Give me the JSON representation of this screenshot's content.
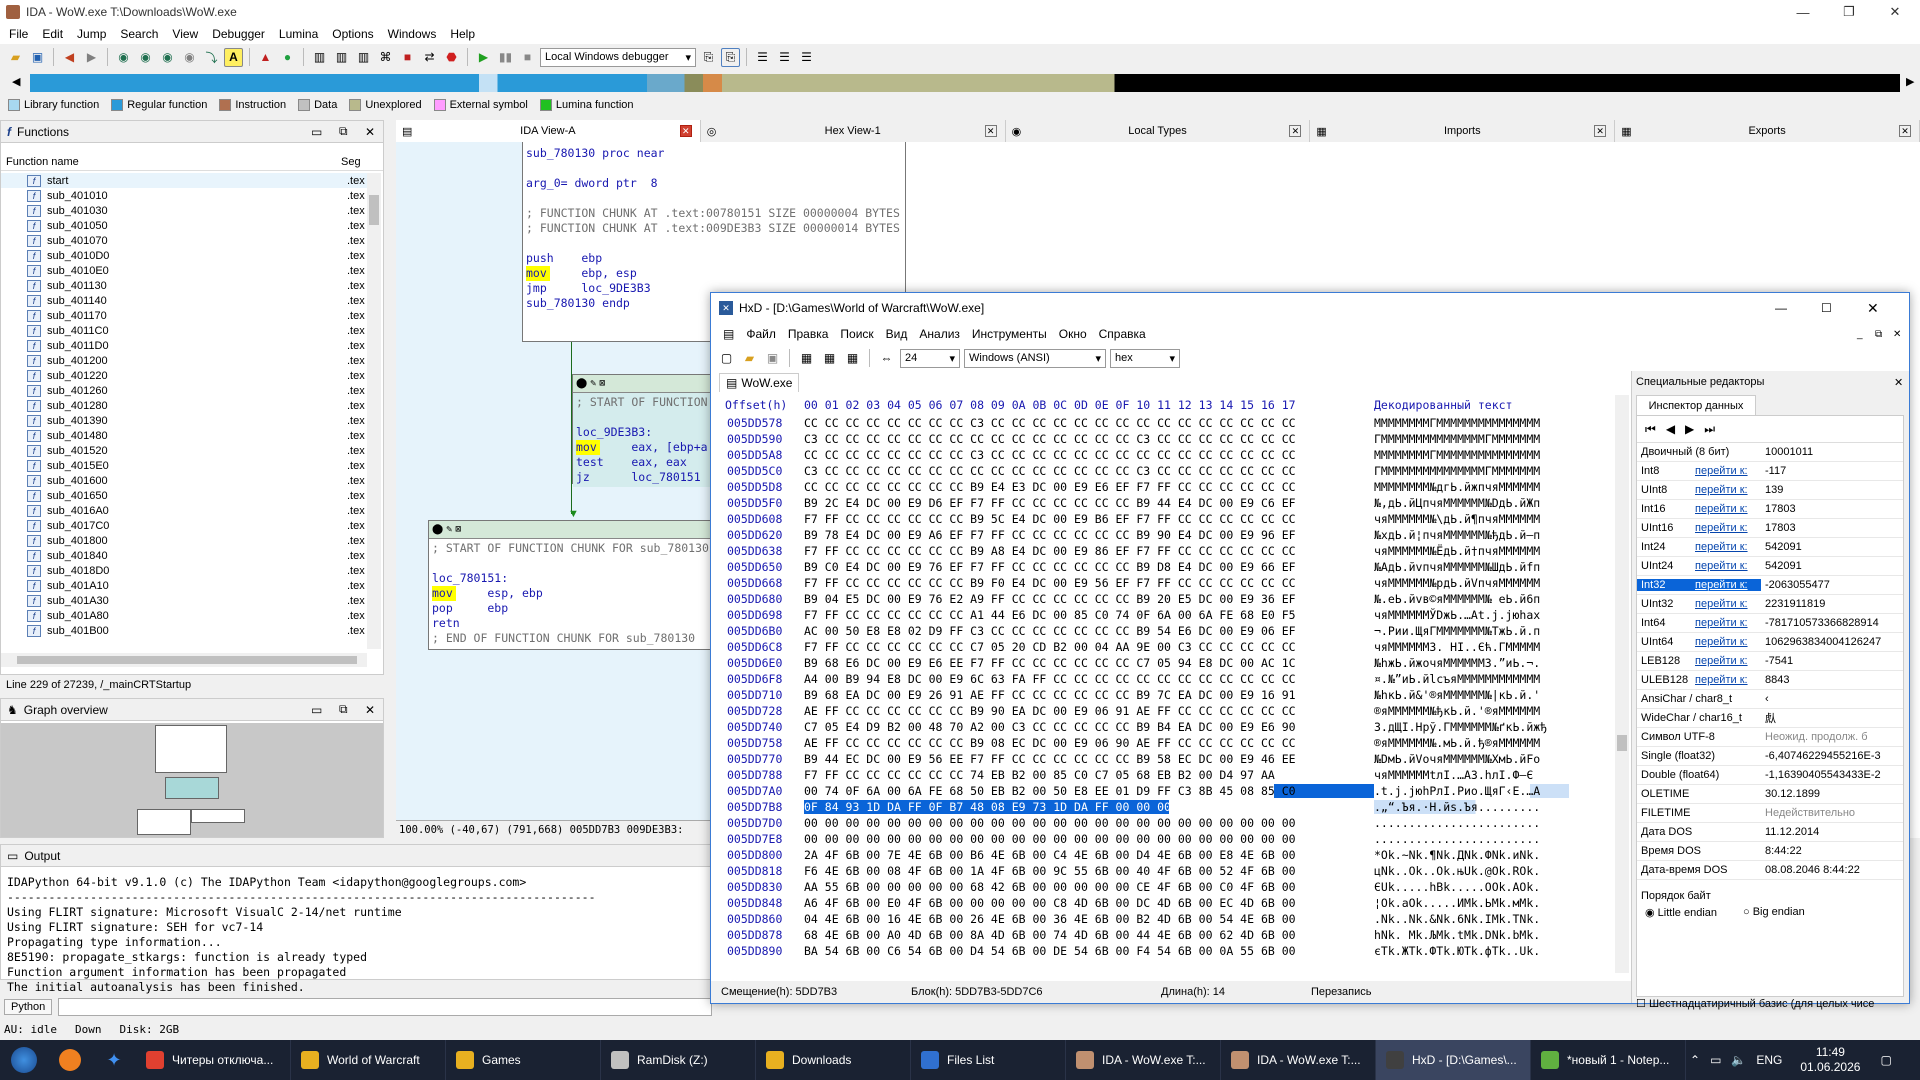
{
  "window": {
    "title": "IDA - WoW.exe T:\\Downloads\\WoW.exe",
    "minimize": "—",
    "maximize": "❐",
    "close": "✕"
  },
  "menu": [
    "File",
    "Edit",
    "Jump",
    "Search",
    "View",
    "Debugger",
    "Lumina",
    "Options",
    "Windows",
    "Help"
  ],
  "toolbar": {
    "debugger": "Local Windows debugger"
  },
  "legend": [
    {
      "label": "Library function",
      "color": "#a8d8f0"
    },
    {
      "label": "Regular function",
      "color": "#2a9ad8"
    },
    {
      "label": "Instruction",
      "color": "#b07050"
    },
    {
      "label": "Data",
      "color": "#c0c0c0"
    },
    {
      "label": "Unexplored",
      "color": "#b8b98c"
    },
    {
      "label": "External symbol",
      "color": "#ff9cff"
    },
    {
      "label": "Lumina function",
      "color": "#20c020"
    }
  ],
  "functions": {
    "title": "Functions",
    "col_name": "Function name",
    "col_seg": "Seg",
    "items": [
      "start",
      "sub_401010",
      "sub_401030",
      "sub_401050",
      "sub_401070",
      "sub_4010D0",
      "sub_4010E0",
      "sub_401130",
      "sub_401140",
      "sub_401170",
      "sub_4011C0",
      "sub_4011D0",
      "sub_401200",
      "sub_401220",
      "sub_401260",
      "sub_401280",
      "sub_401390",
      "sub_401480",
      "sub_401520",
      "sub_4015E0",
      "sub_401600",
      "sub_401650",
      "sub_4016A0",
      "sub_4017C0",
      "sub_401800",
      "sub_401840",
      "sub_4018D0",
      "sub_401A10",
      "sub_401A30",
      "sub_401A80",
      "sub_401B00"
    ],
    "seg": ".tex",
    "status": "Line 229 of 27239, /_mainCRTStartup"
  },
  "graph_overview": {
    "title": "Graph overview"
  },
  "tabs": [
    {
      "label": "IDA View-A",
      "icon": "▤"
    },
    {
      "label": "Hex View-1",
      "icon": "◎"
    },
    {
      "label": "Local Types",
      "icon": "◉"
    },
    {
      "label": "Imports",
      "icon": "▦"
    },
    {
      "label": "Exports",
      "icon": "▦"
    }
  ],
  "ida_nodes": {
    "n1": [
      "sub_780130 proc near",
      "",
      "arg_0= dword ptr  8",
      "",
      "; FUNCTION CHUNK AT .text:00780151 SIZE 00000004 BYTES",
      "; FUNCTION CHUNK AT .text:009DE3B3 SIZE 00000014 BYTES",
      "",
      "push    ebp",
      "mov     ebp, esp",
      "jmp     loc_9DE3B3",
      "sub_780130 endp"
    ],
    "n2": [
      "; START OF FUNCTION",
      "",
      "loc_9DE3B3:",
      "mov     eax, [ebp+a",
      "test    eax, eax",
      "jz      loc_780151"
    ],
    "n3": [
      "; START OF FUNCTION CHUNK FOR sub_780130",
      "",
      "loc_780151:",
      "mov     esp, ebp",
      "pop     ebp",
      "retn",
      "; END OF FUNCTION CHUNK FOR sub_780130"
    ]
  },
  "graph_status": "100.00% (-40,67) (791,668) 005DD7B3 009DE3B3:",
  "output": {
    "title": "Output",
    "lines": [
      "IDAPython 64-bit v9.1.0 (c) The IDAPython Team <idapython@googlegroups.com>",
      "-------------------------------------------------------------------------------------",
      "Using FLIRT signature: Microsoft VisualC 2-14/net runtime",
      "Using FLIRT signature: SEH for vc7-14",
      "Propagating type information...",
      "8E5190: propagate_stkargs: function is already typed",
      "Function argument information has been propagated",
      "The initial autoanalysis has been finished."
    ]
  },
  "python_btn": "Python",
  "status": {
    "au": "AU:  idle",
    "down": "Down",
    "disk": "Disk: 2GB"
  },
  "hxd": {
    "title": "HxD - [D:\\Games\\World of Warcraft\\WoW.exe]",
    "menu": [
      "Файл",
      "Правка",
      "Поиск",
      "Вид",
      "Анализ",
      "Инструменты",
      "Окно",
      "Справка"
    ],
    "bytes_per_row": "24",
    "encoding": "Windows (ANSI)",
    "base": "hex",
    "file_tab": "WoW.exe",
    "header_offset": "Offset(h)",
    "header_cols": "00 01 02 03 04 05 06 07 08 09 0A 0B 0C 0D 0E 0F 10 11 12 13 14 15 16 17",
    "header_decoded": "Декодированный текст",
    "rows": [
      [
        "005DD578",
        "CC CC CC CC CC CC CC CC C3 CC CC CC CC CC CC CC CC CC CC CC CC CC CC CC",
        "ММММММММГМММММММММММММММ"
      ],
      [
        "005DD590",
        "C3 CC CC CC CC CC CC CC CC CC CC CC CC CC CC CC C3 CC CC CC CC CC CC CC",
        "ГМММММММММММММММГМММММММ"
      ],
      [
        "005DD5A8",
        "CC CC CC CC CC CC CC CC C3 CC CC CC CC CC CC CC CC CC CC CC CC CC CC CC",
        "ММММММММГМММММММММММММММ"
      ],
      [
        "005DD5C0",
        "C3 CC CC CC CC CC CC CC CC CC CC CC CC CC CC CC C3 CC CC CC CC CC CC CC",
        "ГМММММММММММММММГМММММММ"
      ],
      [
        "005DD5D8",
        "CC CC CC CC CC CC CC CC B9 E4 E3 DC 00 E9 E6 EF F7 FF CC CC CC CC CC CC",
        "ММММММММ№дгЬ.йжпчяММММММ"
      ],
      [
        "005DD5F0",
        "B9 2C E4 DC 00 E9 D6 EF F7 FF CC CC CC CC CC CC B9 44 E4 DC 00 E9 C6 EF",
        "№,дЬ.йЦпчяММММММ№DдЬ.йЖп"
      ],
      [
        "005DD608",
        "F7 FF CC CC CC CC CC CC B9 5C E4 DC 00 E9 B6 EF F7 FF CC CC CC CC CC CC",
        "чяММММММ№\\дЬ.й¶пчяММММММ"
      ],
      [
        "005DD620",
        "B9 78 E4 DC 00 E9 A6 EF F7 FF CC CC CC CC CC CC B9 90 E4 DC 00 E9 96 EF",
        "№xдЬ.й¦пчяММММММ№ђдЬ.й–п"
      ],
      [
        "005DD638",
        "F7 FF CC CC CC CC CC CC B9 A8 E4 DC 00 E9 86 EF F7 FF CC CC CC CC CC CC",
        "чяММММММ№ЁдЬ.й†пчяММММММ"
      ],
      [
        "005DD650",
        "B9 C0 E4 DC 00 E9 76 EF F7 FF CC CC CC CC CC CC B9 D8 E4 DC 00 E9 66 EF",
        "№АдЬ.йvпчяММММММ№ШдЬ.йfп"
      ],
      [
        "005DD668",
        "F7 FF CC CC CC CC CC CC B9 F0 E4 DC 00 E9 56 EF F7 FF CC CC CC CC CC CC",
        "чяММММММ№рдЬ.йVпчяММММММ"
      ],
      [
        "005DD680",
        "B9 04 E5 DC 00 E9 76 E2 A9 FF CC CC CC CC CC CC B9 20 E5 DC 00 E9 36 EF",
        "№.еЬ.йvв©яММММММ№ еЬ.й6п"
      ],
      [
        "005DD698",
        "F7 FF CC CC CC CC CC CC A1 44 E6 DC 00 85 C0 74 0F 6A 00 6A FE 68 E0 F5",
        "чяММММММЎDжЬ.…Аt.j.jюhаx"
      ],
      [
        "005DD6B0",
        "AC 00 50 E8 E8 02 D9 FF C3 CC CC CC CC CC CC CC B9 54 E6 DC 00 E9 06 EF",
        "¬.Pии.ЩяГМММММММ№TжЬ.й.п"
      ],
      [
        "005DD6C8",
        "F7 FF CC CC CC CC CC CC C7 05 20 CD B2 00 04 AA 9E 00 C3 CC CC CC CC CC",
        "чяММММММЗ. НІ..Єћ.ГМММММ"
      ],
      [
        "005DD6E0",
        "B9 68 E6 DC 00 E9 E6 EE F7 FF CC CC CC CC CC CC C7 05 94 E8 DC 00 AC 1C",
        "№hжЬ.йжочяММММММЗ.”иЬ.¬."
      ],
      [
        "005DD6F8",
        "A4 00 B9 94 E8 DC 00 E9 6C 63 FA FF CC CC CC CC CC CC CC CC CC CC CC CC",
        "¤.№”иЬ.йlсъяММММММММММММ"
      ],
      [
        "005DD710",
        "B9 68 EA DC 00 E9 26 91 AE FF CC CC CC CC CC CC B9 7C EA DC 00 E9 16 91",
        "№hкЬ.й&'®яММММММ№|кЬ.й.'"
      ],
      [
        "005DD728",
        "AE FF CC CC CC CC CC CC B9 90 EA DC 00 E9 06 91 AE FF CC CC CC CC CC CC",
        "®яММММММ№ђкЬ.й.'®яММММММ"
      ],
      [
        "005DD740",
        "C7 05 E4 D9 B2 00 48 70 A2 00 C3 CC CC CC CC CC B9 B4 EA DC 00 E9 E6 90",
        "З.дЩІ.Hpў.ГММММММ№ґкЬ.йжђ"
      ],
      [
        "005DD758",
        "AE FF CC CC CC CC CC CC B9 08 EC DC 00 E9 06 90 AE FF CC CC CC CC CC CC",
        "®яММММММ№.мЬ.й.ђ®яММММММ"
      ],
      [
        "005DD770",
        "B9 44 EC DC 00 E9 56 EE F7 FF CC CC CC CC CC CC B9 58 EC DC 00 E9 46 EE",
        "№DмЬ.йVочяММММММ№XмЬ.йFо"
      ],
      [
        "005DD788",
        "F7 FF CC CC CC CC CC CC 74 EB B2 00 85 C0 C7 05 68 EB B2 00 D4 97 AA",
        "чяММММММtлІ.…АЗ.hлІ.Ф—Є"
      ],
      [
        "005DD7A0",
        "00 74 0F 6A 00 6A FE 68 50 EB B2 00 50 E8 EE 01 D9 FF C3 8B 45 08 85 C0",
        ".t.j.jюhPлІ.Pио.ЩяГ‹E.…А"
      ],
      [
        "005DD7B8",
        "0F 84 93 1D DA FF 0F B7 48 08 E9 73 1D DA FF 00 00 00 00 00 00 00 00 00",
        ".„“.Ъя.·H.йs.Ъя........."
      ],
      [
        "005DD7D0",
        "00 00 00 00 00 00 00 00 00 00 00 00 00 00 00 00 00 00 00 00 00 00 00 00",
        "........................"
      ],
      [
        "005DD7E8",
        "00 00 00 00 00 00 00 00 00 00 00 00 00 00 00 00 00 00 00 00 00 00 00 00",
        "........................"
      ],
      [
        "005DD800",
        "2A 4F 6B 00 7E 4E 6B 00 B6 4E 6B 00 C4 4E 6B 00 D4 4E 6B 00 E8 4E 6B 00",
        "*Ok.~Nk.¶Nk.ДNk.ФNk.иNk."
      ],
      [
        "005DD818",
        "F6 4E 6B 00 08 4F 6B 00 1A 4F 6B 00 9C 55 6B 00 40 4F 6B 00 52 4F 6B 00",
        "цNk..Ok..Ok.њUk.@Ok.ROk."
      ],
      [
        "005DD830",
        "AA 55 6B 00 00 00 00 00 68 42 6B 00 00 00 00 00 CE 4F 6B 00 C0 4F 6B 00",
        "ЄUk.....hBk.....ОOk.АOk."
      ],
      [
        "005DD848",
        "A6 4F 6B 00 E0 4F 6B 00 00 00 00 00 C8 4D 6B 00 DC 4D 6B 00 EC 4D 6B 00",
        "¦Ok.аOk.....ИMk.ЬMk.мMk."
      ],
      [
        "005DD860",
        "04 4E 6B 00 16 4E 6B 00 26 4E 6B 00 36 4E 6B 00 B2 4D 6B 00 54 4E 6B 00",
        ".Nk..Nk.&Nk.6Nk.ІMk.TNk."
      ],
      [
        "005DD878",
        "68 4E 6B 00 A0 4D 6B 00 8A 4D 6B 00 74 4D 6B 00 44 4E 6B 00 62 4D 6B 00",
        "hNk. Mk.ЉMk.tMk.DNk.bMk."
      ],
      [
        "005DD890",
        "BA 54 6B 00 C6 54 6B 00 D4 54 6B 00 DE 54 6B 00 F4 54 6B 00 0A 55 6B 00",
        "єTk.ЖTk.ФTk.ЮTk.фTk..Uk."
      ]
    ],
    "status": {
      "offset": "Смещение(h): 5DD7B3",
      "block": "Блок(h): 5DD7B3-5DD7C6",
      "length": "Длина(h): 14",
      "mode": "Перезапись"
    }
  },
  "inspector": {
    "title": "Специальные редакторы",
    "tab": "Инспектор данных",
    "link": "перейти к:",
    "rows": [
      {
        "name": "Двоичный (8 бит)",
        "value": "10001011",
        "wide": true
      },
      {
        "name": "Int8",
        "value": "-117"
      },
      {
        "name": "UInt8",
        "value": "139"
      },
      {
        "name": "Int16",
        "value": "17803"
      },
      {
        "name": "UInt16",
        "value": "17803"
      },
      {
        "name": "Int24",
        "value": "542091"
      },
      {
        "name": "UInt24",
        "value": "542091"
      },
      {
        "name": "Int32",
        "value": "-2063055477",
        "hi": true
      },
      {
        "name": "UInt32",
        "value": "2231911819"
      },
      {
        "name": "Int64",
        "value": "-781710573366828914"
      },
      {
        "name": "UInt64",
        "value": "1062963834004126247"
      },
      {
        "name": "LEB128",
        "value": "-7541"
      },
      {
        "name": "ULEB128",
        "value": "8843"
      },
      {
        "name": "AnsiChar / char8_t",
        "value": "‹",
        "wide": true
      },
      {
        "name": "WideChar / char16_t",
        "value": "䖋",
        "wide": true
      },
      {
        "name": "Символ UTF-8",
        "value": "Неожид. продолж. б",
        "wide": true,
        "gray": true
      },
      {
        "name": "Single (float32)",
        "value": "-6,40746229455216E-3",
        "wide": true
      },
      {
        "name": "Double (float64)",
        "value": "-1,16390405543433E-2",
        "wide": true
      },
      {
        "name": "OLETIME",
        "value": "30.12.1899",
        "wide": true
      },
      {
        "name": "FILETIME",
        "value": "Недействительно",
        "wide": true,
        "gray": true
      },
      {
        "name": "Дата DOS",
        "value": "11.12.2014",
        "wide": true
      },
      {
        "name": "Время DOS",
        "value": "8:44:22",
        "wide": true
      },
      {
        "name": "Дата-время DOS",
        "value": "08.08.2046 8:44:22",
        "wide": true
      }
    ],
    "byte_order": "Порядок байт",
    "little": "Little endian",
    "big": "Big endian",
    "hex_basis": "Шестнадцатиричный базис (для целых чисе"
  },
  "taskbar": [
    {
      "label": "Читеры отключа...",
      "color": "#e04030"
    },
    {
      "label": "World of Warcraft",
      "color": "#e8b020"
    },
    {
      "label": "Games",
      "color": "#e8b020"
    },
    {
      "label": "RamDisk (Z:)",
      "color": "#c0c0c0"
    },
    {
      "label": "Downloads",
      "color": "#e8b020"
    },
    {
      "label": "Files List",
      "color": "#3070d0"
    },
    {
      "label": "IDA - WoW.exe T:...",
      "color": "#c09070"
    },
    {
      "label": "IDA - WoW.exe T:...",
      "color": "#c09070"
    },
    {
      "label": "HxD - [D:\\Games\\...",
      "color": "#404040"
    },
    {
      "label": "*новый 1 - Notep...",
      "color": "#60b040"
    }
  ],
  "tray": {
    "lang": "ENG",
    "time": "11:49",
    "date": "01.06.2026"
  }
}
